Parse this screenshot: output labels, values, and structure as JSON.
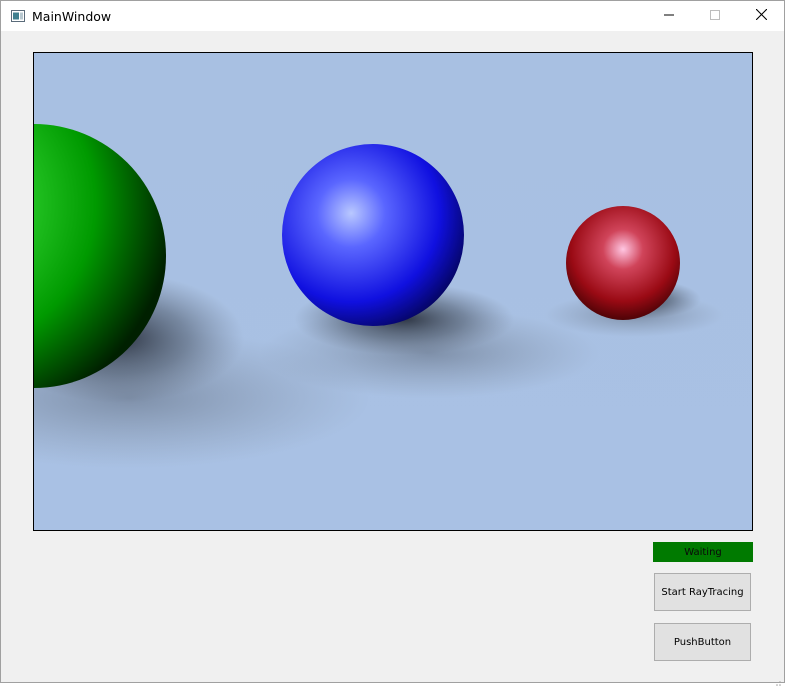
{
  "window": {
    "title": "MainWindow",
    "controls": {
      "minimize": "minimize-icon",
      "maximize": "maximize-icon",
      "close": "close-icon"
    }
  },
  "scene": {
    "background_color": "#a9c1e3",
    "spheres": [
      {
        "name": "green-sphere",
        "color": "#00a800"
      },
      {
        "name": "blue-sphere",
        "color": "#1010e0"
      },
      {
        "name": "red-sphere",
        "color": "#9a0a14"
      }
    ]
  },
  "status": {
    "label": "Waiting",
    "color": "#007a00"
  },
  "buttons": {
    "start_label": "Start RayTracing",
    "push_label": "PushButton"
  }
}
